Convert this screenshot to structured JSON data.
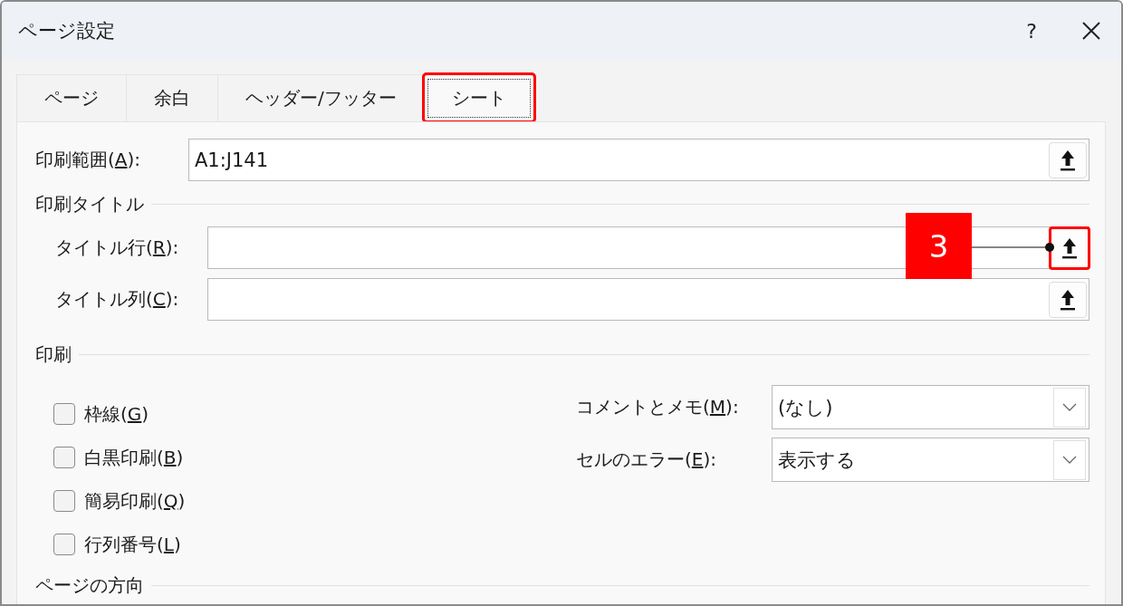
{
  "window": {
    "title": "ページ設定",
    "help": "?"
  },
  "tabs": [
    {
      "label": "ページ",
      "selected": false,
      "highlighted": false
    },
    {
      "label": "余白",
      "selected": false,
      "highlighted": false
    },
    {
      "label": "ヘッダー/フッター",
      "selected": false,
      "highlighted": false
    },
    {
      "label": "シート",
      "selected": true,
      "highlighted": true
    }
  ],
  "print_area": {
    "label": {
      "before": "印刷範囲(",
      "accel": "A",
      "after": "):"
    },
    "value": "A1:J141",
    "button_highlighted": false
  },
  "print_titles": {
    "heading": "印刷タイトル",
    "rows": [
      {
        "label": {
          "before": "タイトル行(",
          "accel": "R",
          "after": "):"
        },
        "button_highlighted": true,
        "callout": "3"
      },
      {
        "label": {
          "before": "タイトル列(",
          "accel": "C",
          "after": "):"
        },
        "button_highlighted": false
      }
    ]
  },
  "print": {
    "heading": "印刷",
    "checkboxes": [
      {
        "label": {
          "before": "枠線(",
          "accel": "G",
          "after": ")"
        },
        "checked": false
      },
      {
        "label": {
          "before": "白黒印刷(",
          "accel": "B",
          "after": ")"
        },
        "checked": false
      },
      {
        "label": {
          "before": "簡易印刷(",
          "accel": "Q",
          "after": ")"
        },
        "checked": false
      },
      {
        "label": {
          "before": "行列番号(",
          "accel": "L",
          "after": ")"
        },
        "checked": false
      }
    ],
    "dropdowns": [
      {
        "label": {
          "before": "コメントとメモ(",
          "accel": "M",
          "after": "):"
        },
        "value": "(なし)"
      },
      {
        "label": {
          "before": "セルのエラー(",
          "accel": "E",
          "after": "):"
        },
        "value": "表示する"
      }
    ]
  },
  "orientation": {
    "heading": "ページの方向"
  }
}
